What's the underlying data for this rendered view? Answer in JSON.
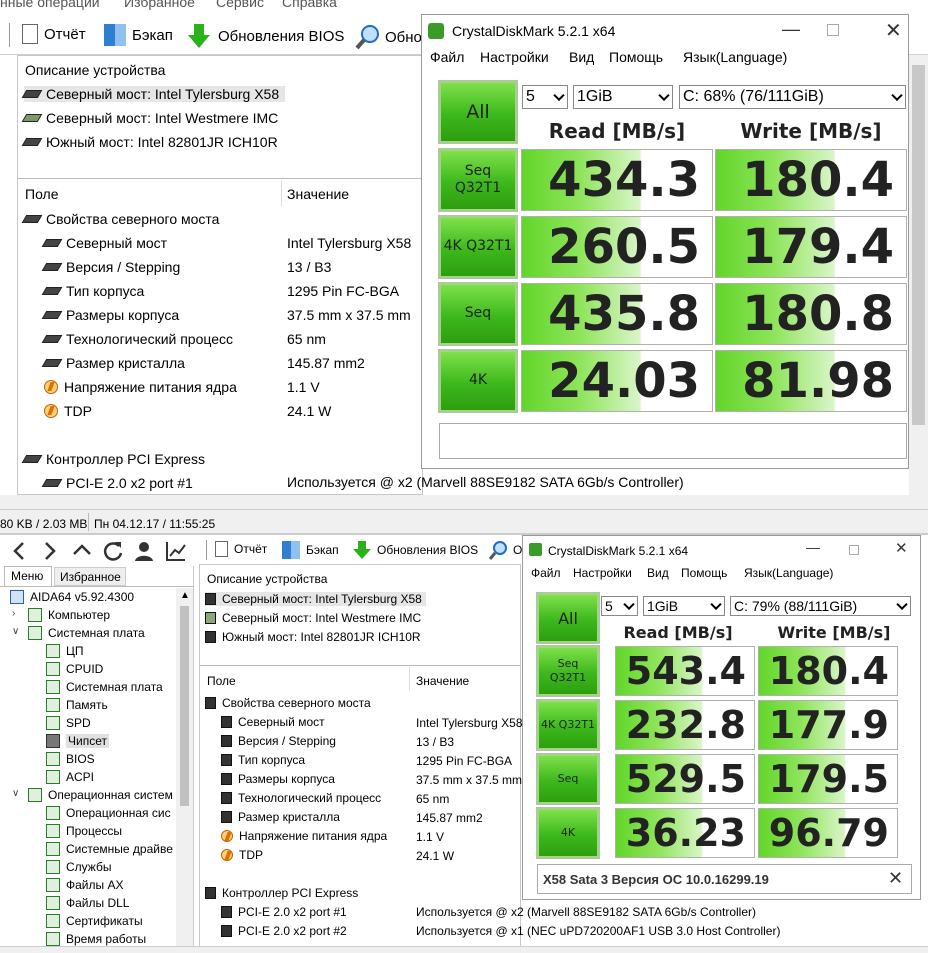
{
  "top": {
    "menu": [
      "нные операции",
      "Избранное",
      "Сервис",
      "Справка"
    ],
    "toolbar": {
      "report": "Отчёт",
      "backup": "Бэкап",
      "bios": "Обновления BIOS",
      "find": "Обно"
    },
    "devices_header": "Описание устройства",
    "devices": [
      "Северный мост: Intel Tylersburg X58",
      "Северный мост: Intel Westmere IMC",
      "Южный мост: Intel 82801JR ICH10R"
    ],
    "col_field": "Поле",
    "col_value": "Значение",
    "group1": "Свойства северного моста",
    "props": [
      {
        "name": "Северный мост",
        "value": "Intel Tylersburg X58"
      },
      {
        "name": "Версия / Stepping",
        "value": "13 / B3"
      },
      {
        "name": "Тип корпуса",
        "value": "1295 Pin FC-BGA"
      },
      {
        "name": "Размеры корпуса",
        "value": "37.5 mm x 37.5 mm"
      },
      {
        "name": "Технологический процесс",
        "value": "65 nm"
      },
      {
        "name": "Размер кристалла",
        "value": "145.87 mm2"
      },
      {
        "name": "Напряжение питания ядра",
        "value": "1.1 V"
      },
      {
        "name": "TDP",
        "value": "24.1 W"
      }
    ],
    "group2": "Контроллер PCI Express",
    "pci": {
      "name": "PCI-E 2.0 x2 port #1",
      "value": "Используется @ x2  (Marvell 88SE9182 SATA 6Gb/s Controller)"
    },
    "status_left": "80 KB / 2.03 MB",
    "status_right": "Пн 04.12.17 / 11:55:25"
  },
  "cdm1": {
    "title": "CrystalDiskMark 5.2.1 x64",
    "menu": [
      "Файл",
      "Настройки",
      "Вид",
      "Помощь",
      "Язык(Language)"
    ],
    "all": "All",
    "count": "5",
    "size": "1GiB",
    "drive": "C: 68% (76/111GiB)",
    "read_hdr": "Read [MB/s]",
    "write_hdr": "Write [MB/s]",
    "rows": [
      {
        "label": "Seq Q32T1",
        "read": "434.3",
        "write": "180.4"
      },
      {
        "label": "4K Q32T1",
        "read": "260.5",
        "write": "179.4"
      },
      {
        "label": "Seq",
        "read": "435.8",
        "write": "180.8"
      },
      {
        "label": "4K",
        "read": "24.03",
        "write": "81.98"
      }
    ],
    "comment": ""
  },
  "bottom": {
    "sidebar_tabs": [
      "Меню",
      "Избранное"
    ],
    "tree": [
      {
        "label": "AIDA64 v5.92.4300",
        "level": 0
      },
      {
        "label": "Компьютер",
        "level": 1
      },
      {
        "label": "Системная плата",
        "level": 1
      },
      {
        "label": "ЦП",
        "level": 2
      },
      {
        "label": "CPUID",
        "level": 2
      },
      {
        "label": "Системная плата",
        "level": 2
      },
      {
        "label": "Память",
        "level": 2
      },
      {
        "label": "SPD",
        "level": 2
      },
      {
        "label": "Чипсет",
        "level": 2
      },
      {
        "label": "BIOS",
        "level": 2
      },
      {
        "label": "ACPI",
        "level": 2
      },
      {
        "label": "Операционная систем",
        "level": 1
      },
      {
        "label": "Операционная сис",
        "level": 2
      },
      {
        "label": "Процессы",
        "level": 2
      },
      {
        "label": "Системные драйве",
        "level": 2
      },
      {
        "label": "Службы",
        "level": 2
      },
      {
        "label": "Файлы AX",
        "level": 2
      },
      {
        "label": "Файлы DLL",
        "level": 2
      },
      {
        "label": "Сертификаты",
        "level": 2
      },
      {
        "label": "Время работы",
        "level": 2
      }
    ],
    "toolbar": {
      "report": "Отчёт",
      "backup": "Бэкап",
      "bios": "Обновления BIOS",
      "find": "О"
    },
    "devices_header": "Описание устройства",
    "devices": [
      "Северный мост: Intel Tylersburg X58",
      "Северный мост: Intel Westmere IMC",
      "Южный мост: Intel 82801JR ICH10R"
    ],
    "col_field": "Поле",
    "col_value": "Значение",
    "group1": "Свойства северного моста",
    "props": [
      {
        "name": "Северный мост",
        "value": "Intel Tylersburg X58"
      },
      {
        "name": "Версия / Stepping",
        "value": "13 / B3"
      },
      {
        "name": "Тип корпуса",
        "value": "1295 Pin FC-BGA"
      },
      {
        "name": "Размеры корпуса",
        "value": "37.5 mm x 37.5 mm"
      },
      {
        "name": "Технологический процесс",
        "value": "65 nm"
      },
      {
        "name": "Размер кристалла",
        "value": "145.87 mm2"
      },
      {
        "name": "Напряжение питания ядра",
        "value": "1.1 V"
      },
      {
        "name": "TDP",
        "value": "24.1 W"
      }
    ],
    "group2": "Контроллер PCI Express",
    "pci": [
      {
        "name": "PCI-E 2.0 x2 port #1",
        "value": "Используется @ x2  (Marvell 88SE9182 SATA 6Gb/s Controller)"
      },
      {
        "name": "PCI-E 2.0 x2 port #2",
        "value": "Используется @ x1  (NEC uPD720200AF1 USB 3.0 Host Controller)"
      }
    ]
  },
  "cdm2": {
    "title": "CrystalDiskMark 5.2.1 x64",
    "menu": [
      "Файл",
      "Настройки",
      "Вид",
      "Помощь",
      "Язык(Language)"
    ],
    "all": "All",
    "count": "5",
    "size": "1GiB",
    "drive": "C: 79% (88/111GiB)",
    "read_hdr": "Read [MB/s]",
    "write_hdr": "Write [MB/s]",
    "rows": [
      {
        "label": "Seq Q32T1",
        "read": "543.4",
        "write": "180.4"
      },
      {
        "label": "4K Q32T1",
        "read": "232.8",
        "write": "177.9"
      },
      {
        "label": "Seq",
        "read": "529.5",
        "write": "179.5"
      },
      {
        "label": "4K",
        "read": "36.23",
        "write": "96.79"
      }
    ],
    "comment": "X58 Sata 3  Версия ОС 10.0.16299.19"
  }
}
